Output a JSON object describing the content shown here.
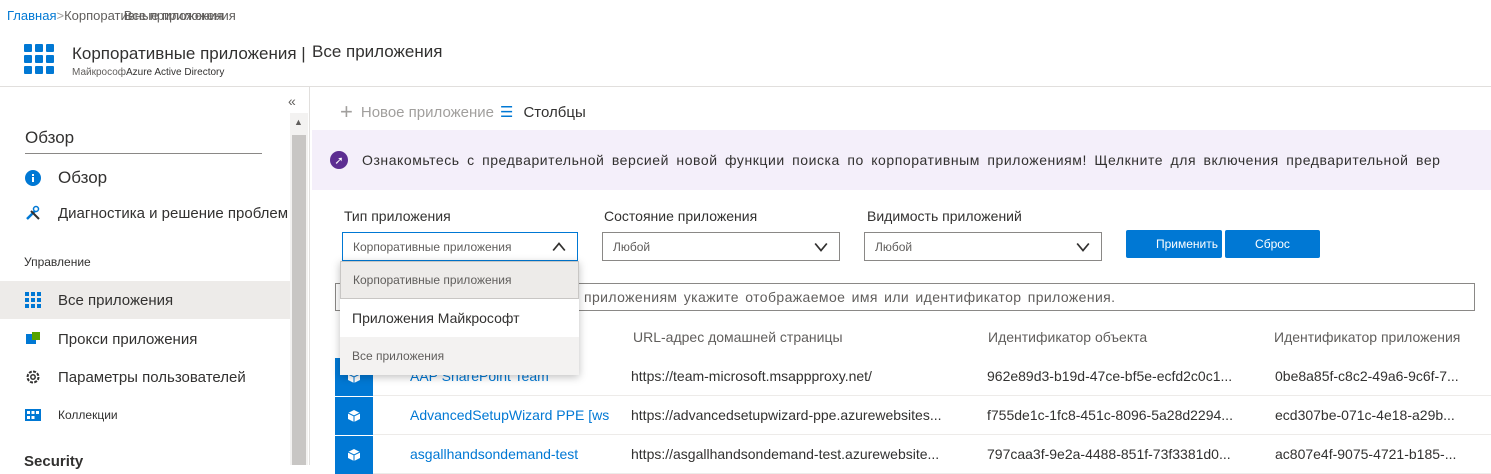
{
  "breadcrumb": {
    "home": "Главная",
    "separator": ">",
    "item1": "Корпоративные приложения",
    "current": "Все приложения"
  },
  "header": {
    "title": "Корпоративные приложения |",
    "title_page": "Все приложения",
    "subtitle_org": "Майкрософ",
    "subtitle_service": "Azure Active Directory",
    "icon": "enterprise-apps-grid-icon"
  },
  "sidebar": {
    "collapse_label": "«",
    "section_title": "Обзор",
    "items_top": [
      {
        "label": "Обзор",
        "icon": "info-icon"
      },
      {
        "label": "Диагностика и решение проблем",
        "icon": "wrench-icon"
      }
    ],
    "group_manage": "Управление",
    "items_manage": [
      {
        "label": "Все приложения",
        "icon": "grid-icon",
        "active": true
      },
      {
        "label": "Прокси приложения",
        "icon": "proxy-icon"
      },
      {
        "label": "Параметры пользователей",
        "icon": "gear-icon"
      },
      {
        "label": "Коллекции",
        "icon": "collections-icon"
      }
    ],
    "group_security": "Security"
  },
  "toolbar": {
    "new_app": "Новое приложение",
    "columns": "Столбцы"
  },
  "banner": {
    "text": "Ознакомьтесь с предварительной версией новой функции поиска по корпоративным приложениям! Щелкните для включения предварительной вер"
  },
  "filters": {
    "app_type_label": "Тип приложения",
    "app_type_value": "Корпоративные приложения",
    "app_state_label": "Состояние приложения",
    "app_state_value": "Любой",
    "visibility_label": "Видимость приложений",
    "visibility_value": "Любой",
    "apply": "Применить",
    "reset": "Сброс"
  },
  "dropdown": {
    "options": [
      "Корпоративные приложения",
      "Приложения Майкрософт",
      "Все приложения"
    ],
    "selected": "Корпоративные приложения"
  },
  "search": {
    "placeholder": "приложениям укажите отображаемое имя или идентификатор приложения."
  },
  "table": {
    "columns": [
      "URL-адрес домашней страницы",
      "Идентификатор объекта",
      "Идентификатор приложения"
    ],
    "rows": [
      {
        "name": "AAP SharePoint Team",
        "url": "https://team-microsoft.msappproxy.net/",
        "object_id": "962e89d3-b19d-47ce-bf5e-ecfd2c0c1...",
        "app_id": "0be8a85f-c8c2-49a6-9c6f-7..."
      },
      {
        "name": "AdvancedSetupWizard PPE [ws",
        "url": "https://advancedsetupwizard-ppe.azurewebsites...",
        "object_id": "f755de1c-1fc8-451c-8096-5a28d2294...",
        "app_id": "ecd307be-071c-4e18-a29b..."
      },
      {
        "name": "asgallhandsondemand-test",
        "url": "https://asgallhandsondemand-test.azurewebsite...",
        "object_id": "797caa3f-9e2a-4488-851f-73f3381d0...",
        "app_id": "ac807e4f-9075-4721-b185-..."
      }
    ]
  },
  "colors": {
    "accent": "#0078d4",
    "banner_bg": "#f4effa",
    "banner_icon": "#5c2d91",
    "active_nav_bg": "#edebe9"
  }
}
